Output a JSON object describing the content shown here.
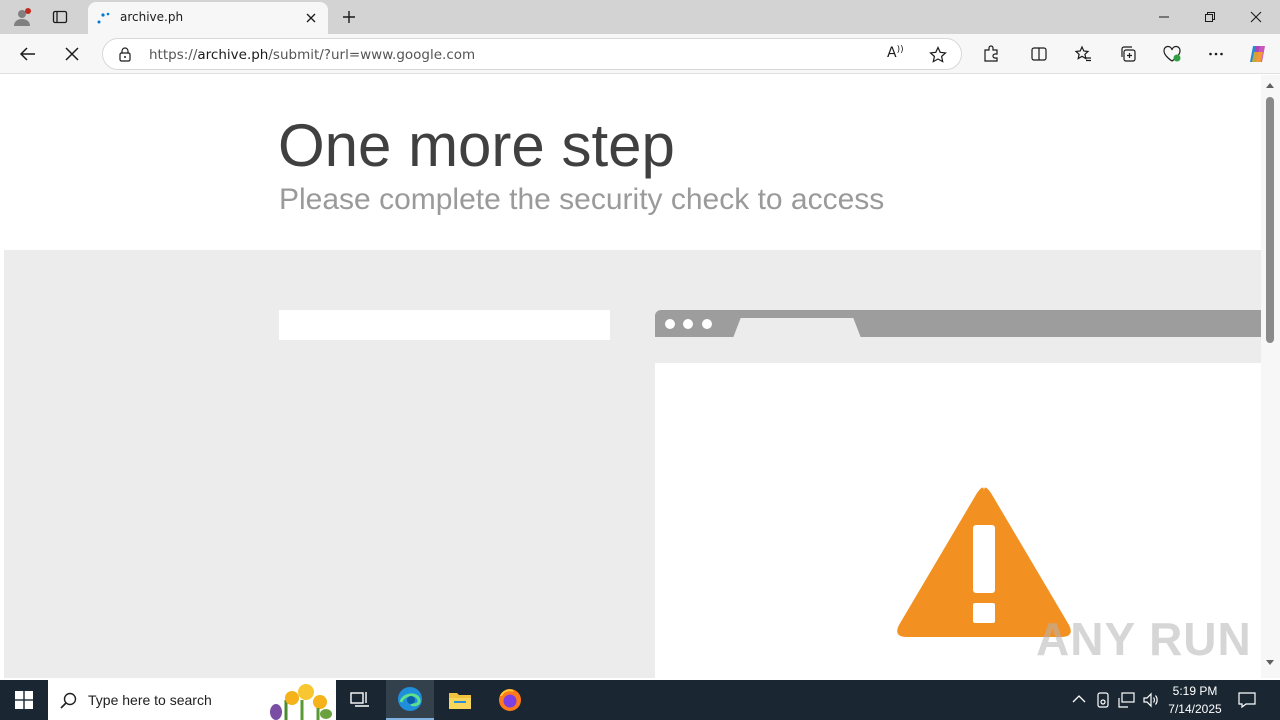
{
  "browser": {
    "tab_title": "archive.ph",
    "url_prefix": "https://",
    "url_host": "archive.ph",
    "url_path": "/submit/?url=www.google.com",
    "read_aloud_label": "A",
    "accent_color": "#0078d4"
  },
  "page": {
    "heading": "One more step",
    "subheading": "Please complete the security check to access",
    "warning_color": "#f29122"
  },
  "watermark": "ANY RUN",
  "taskbar": {
    "search_placeholder": "Type here to search",
    "time": "5:19 PM",
    "date": "7/14/2025"
  }
}
